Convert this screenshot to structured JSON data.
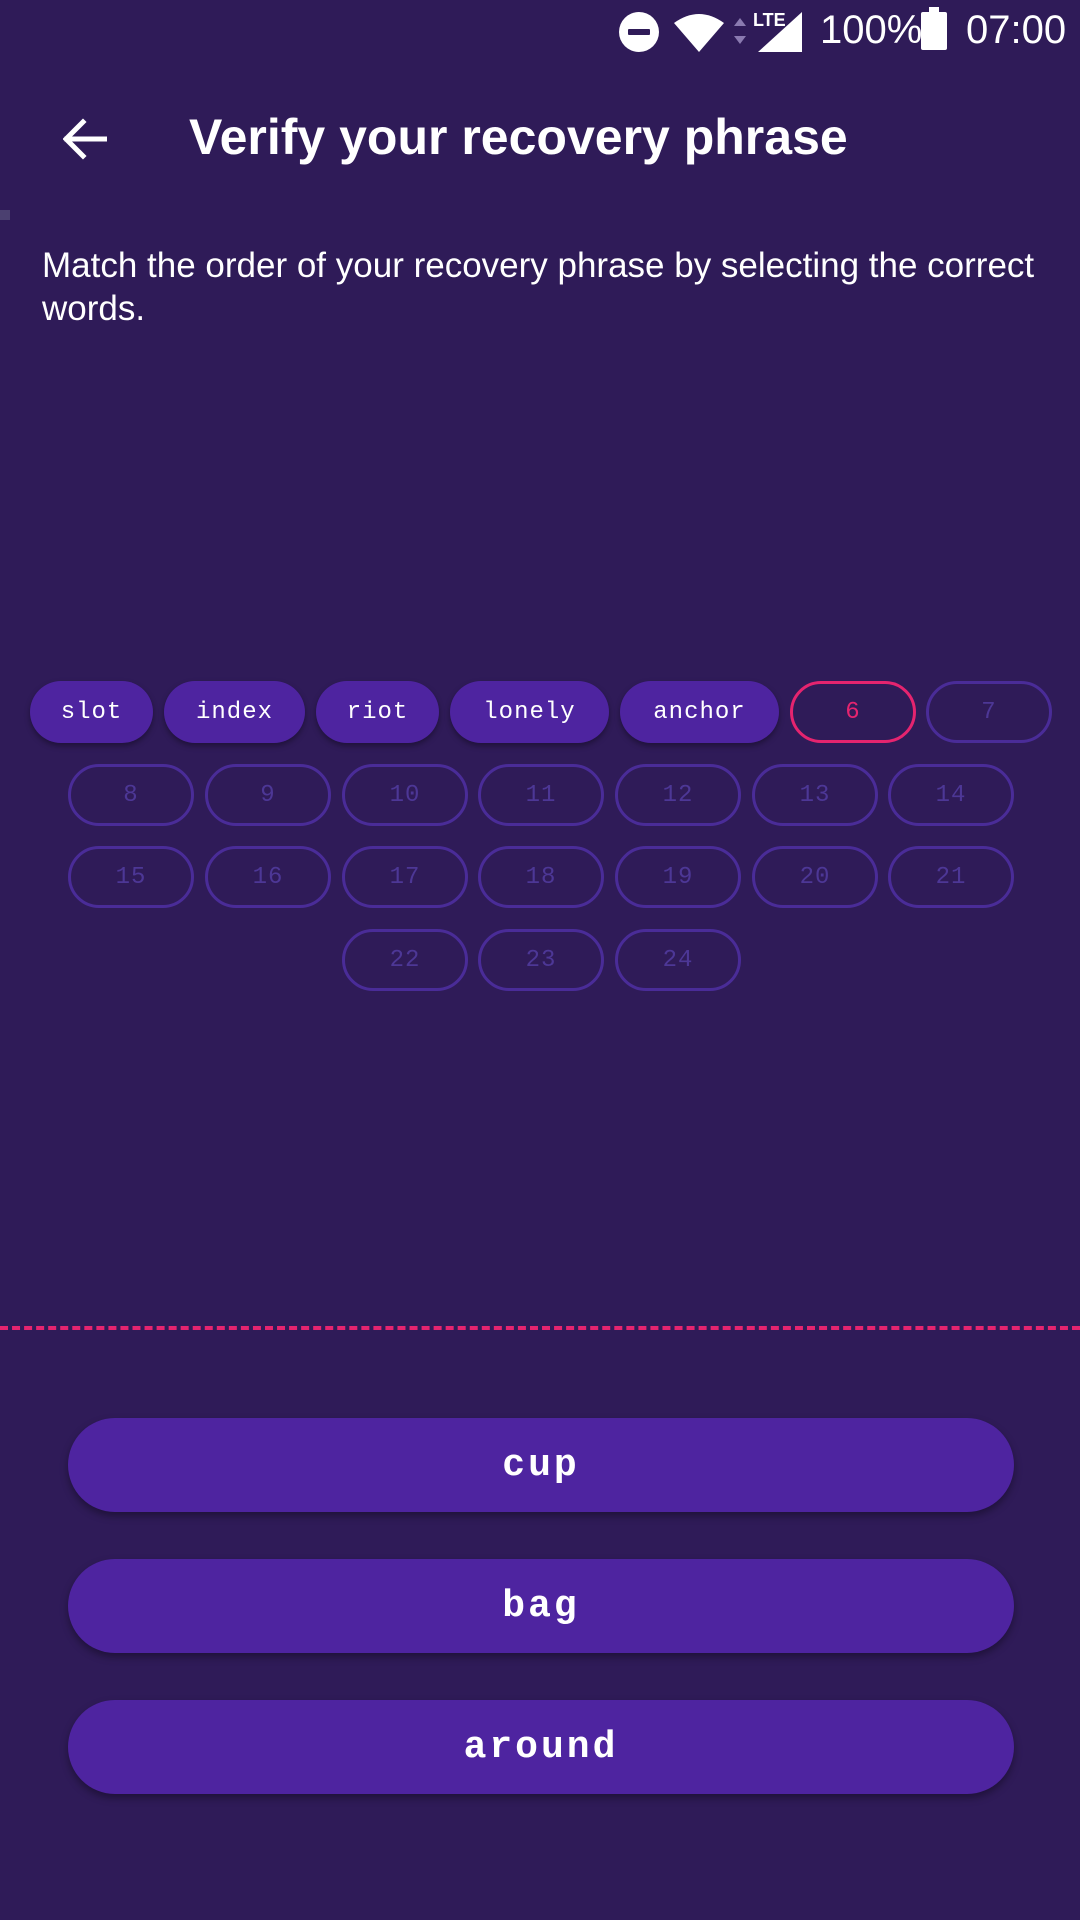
{
  "status_bar": {
    "network": "LTE",
    "battery": "100%",
    "time": "07:00",
    "icons": [
      "do-not-disturb-icon",
      "wifi-icon",
      "data-arrows-icon",
      "cell-signal-icon",
      "battery-icon"
    ]
  },
  "app_bar": {
    "back_icon": "arrow-back-icon",
    "title": "Verify your recovery phrase"
  },
  "instruction": "Match the order of your recovery phrase by selecting the correct words.",
  "phrase_slots": [
    {
      "label": "slot",
      "state": "filled"
    },
    {
      "label": "index",
      "state": "filled"
    },
    {
      "label": "riot",
      "state": "filled"
    },
    {
      "label": "lonely",
      "state": "filled"
    },
    {
      "label": "anchor",
      "state": "filled"
    },
    {
      "label": "6",
      "state": "active"
    },
    {
      "label": "7",
      "state": "empty"
    },
    {
      "label": "8",
      "state": "empty"
    },
    {
      "label": "9",
      "state": "empty"
    },
    {
      "label": "10",
      "state": "empty"
    },
    {
      "label": "11",
      "state": "empty"
    },
    {
      "label": "12",
      "state": "empty"
    },
    {
      "label": "13",
      "state": "empty"
    },
    {
      "label": "14",
      "state": "empty"
    },
    {
      "label": "15",
      "state": "empty"
    },
    {
      "label": "16",
      "state": "empty"
    },
    {
      "label": "17",
      "state": "empty"
    },
    {
      "label": "18",
      "state": "empty"
    },
    {
      "label": "19",
      "state": "empty"
    },
    {
      "label": "20",
      "state": "empty"
    },
    {
      "label": "21",
      "state": "empty"
    },
    {
      "label": "22",
      "state": "empty"
    },
    {
      "label": "23",
      "state": "empty"
    },
    {
      "label": "24",
      "state": "empty"
    }
  ],
  "word_choices": [
    "cup",
    "bag",
    "around"
  ],
  "colors": {
    "background": "#2f1b58",
    "chip_filled": "#4e24a0",
    "chip_outline": "#4a2c98",
    "accent": "#e5246f"
  }
}
